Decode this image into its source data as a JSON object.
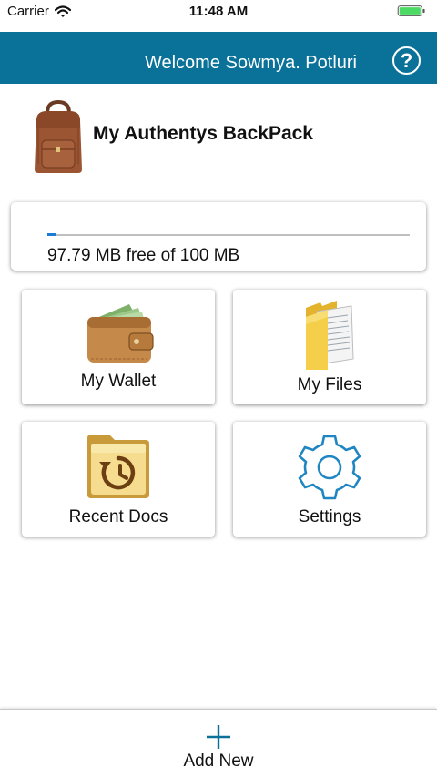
{
  "status_bar": {
    "carrier": "Carrier",
    "time": "11:48 AM"
  },
  "header": {
    "welcome": "Welcome Sowmya. Potluri",
    "help_label": "?",
    "background": "#0a7299"
  },
  "backpack": {
    "title": "My Authentys BackPack"
  },
  "storage": {
    "text": "97.79 MB free of 100 MB",
    "used_fraction": 0.0221,
    "bar_color": "#1a7bd6"
  },
  "tiles": [
    {
      "label": "My Wallet",
      "icon": "wallet-icon"
    },
    {
      "label": "My Files",
      "icon": "folder-icon"
    },
    {
      "label": "Recent Docs",
      "icon": "recent-docs-icon"
    },
    {
      "label": "Settings",
      "icon": "gear-icon"
    }
  ],
  "bottom_bar": {
    "add_label": "Add New"
  }
}
